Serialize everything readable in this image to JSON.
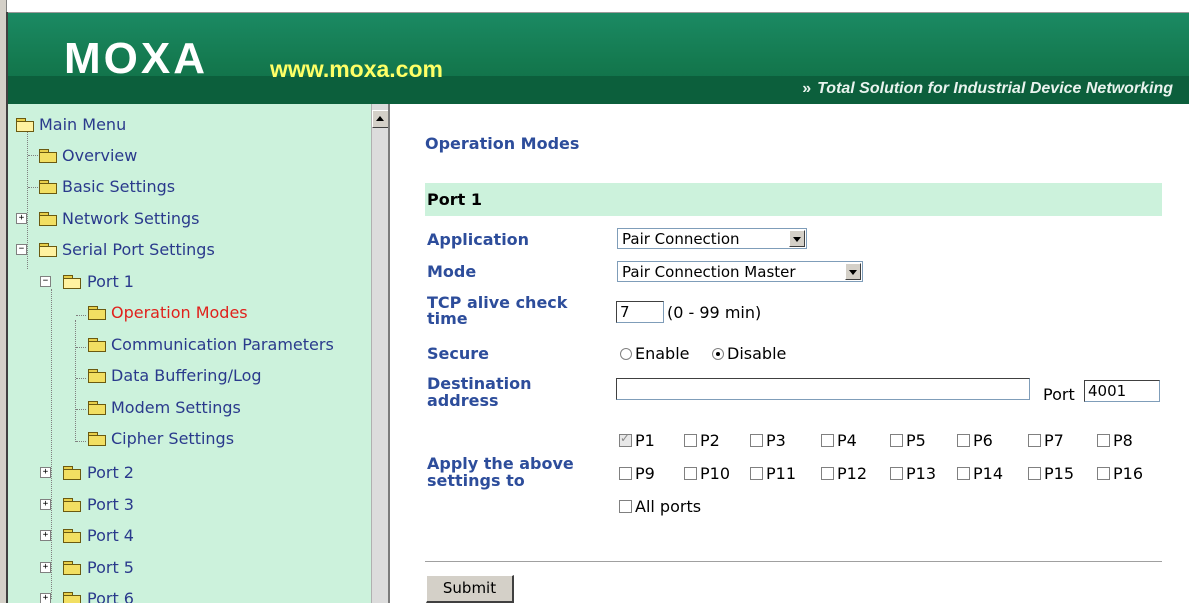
{
  "header": {
    "logo": "MOXA",
    "url": "www.moxa.com",
    "tagline_arrows": "»",
    "tagline": "Total Solution for Industrial Device Networking"
  },
  "sidebar": {
    "items": [
      {
        "label": "Main Menu"
      },
      {
        "label": "Overview"
      },
      {
        "label": "Basic Settings"
      },
      {
        "label": "Network Settings"
      },
      {
        "label": "Serial Port Settings"
      },
      {
        "label": "Port 1"
      },
      {
        "label": "Operation Modes",
        "active": true
      },
      {
        "label": "Communication Parameters"
      },
      {
        "label": "Data Buffering/Log"
      },
      {
        "label": "Modem Settings"
      },
      {
        "label": "Cipher Settings"
      },
      {
        "label": "Port 2"
      },
      {
        "label": "Port 3"
      },
      {
        "label": "Port 4"
      },
      {
        "label": "Port 5"
      },
      {
        "label": "Port 6"
      }
    ]
  },
  "main": {
    "page_title": "Operation Modes",
    "section_title": "Port 1",
    "application": {
      "label": "Application",
      "value": "Pair Connection"
    },
    "mode": {
      "label": "Mode",
      "value": "Pair Connection Master"
    },
    "tcp_alive": {
      "label_line1": "TCP alive check",
      "label_line2": "time",
      "value": "7",
      "range": "(0 - 99 min)"
    },
    "secure": {
      "label": "Secure",
      "enable": "Enable",
      "disable": "Disable",
      "selected": "Disable"
    },
    "destination": {
      "label_line1": "Destination",
      "label_line2": "address",
      "value": "",
      "port_label": "Port",
      "port_value": "4001"
    },
    "apply": {
      "label_line1": "Apply the above",
      "label_line2": "settings to",
      "ports": [
        "P1",
        "P2",
        "P3",
        "P4",
        "P5",
        "P6",
        "P7",
        "P8",
        "P9",
        "P10",
        "P11",
        "P12",
        "P13",
        "P14",
        "P15",
        "P16"
      ],
      "checked": [
        "P1"
      ],
      "all_ports": "All ports"
    },
    "submit_label": "Submit"
  },
  "colors": {
    "header_green": "#14794f",
    "url_yellow": "#ffff66",
    "sidebar_bg": "#ccf2dc",
    "link_blue": "#2a3a8c",
    "active_red": "#e0211c",
    "label_blue": "#2d4d9b"
  }
}
